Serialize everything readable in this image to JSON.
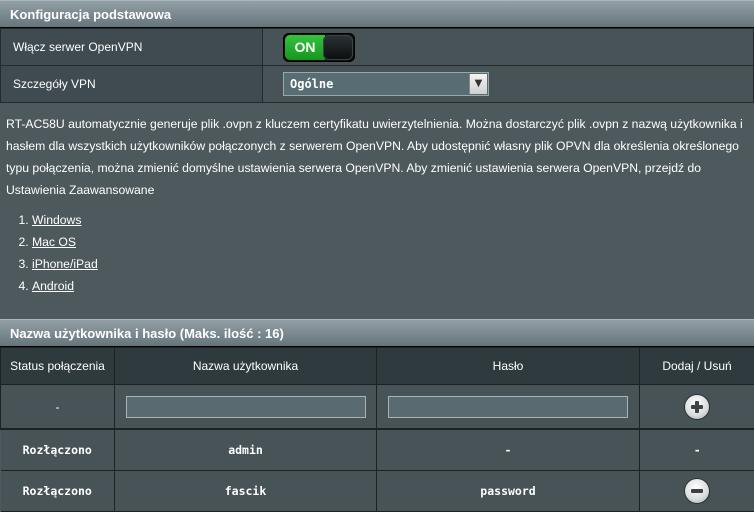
{
  "basic": {
    "header": "Konfiguracja podstawowa",
    "enable_label": "Włącz serwer OpenVPN",
    "toggle_text": "ON",
    "vpn_details_label": "Szczegóły VPN",
    "vpn_details_value": "Ogólne"
  },
  "description": "RT-AC58U automatycznie generuje plik .ovpn z kluczem certyfikatu uwierzytelnienia. Można dostarczyć plik .ovpn z nazwą użytkownika i hasłem dla wszystkich użytkowników połączonych z serwerem OpenVPN. Aby udostępnić własny plik OPVN dla określenia określonego typu połączenia, można zmienić domyślne ustawienia serwera OpenVPN. Aby zmienić ustawienia serwera OpenVPN, przejdź do Ustawienia Zaawansowane",
  "os_links": [
    "Windows",
    "Mac OS",
    "iPhone/iPad",
    "Android"
  ],
  "users": {
    "header": "Nazwa użytkownika i hasło (Maks. ilość : 16)",
    "columns": [
      "Status połączenia",
      "Nazwa użytkownika",
      "Hasło",
      "Dodaj / Usuń"
    ],
    "input_row_status": "-",
    "rows": [
      {
        "status": "Rozłączono",
        "username": "admin",
        "password": "-",
        "action": "-"
      },
      {
        "status": "Rozłączono",
        "username": "fascik",
        "password": "password",
        "action": "remove-icon"
      }
    ]
  },
  "colors": {
    "background": "#4d595d",
    "toggle_on": "#22ad2c"
  }
}
